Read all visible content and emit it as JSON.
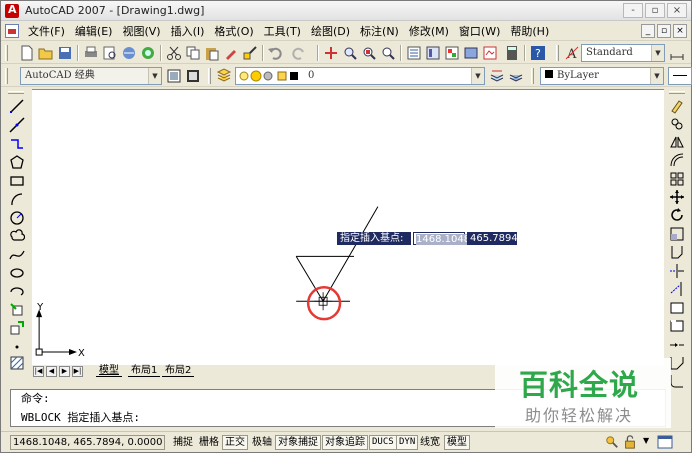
{
  "window": {
    "title": "AutoCAD 2007 - [Drawing1.dwg]",
    "controls": [
      "-",
      "▫",
      "×"
    ]
  },
  "menubar": {
    "items": [
      "文件(F)",
      "编辑(E)",
      "视图(V)",
      "插入(I)",
      "格式(O)",
      "工具(T)",
      "绘图(D)",
      "标注(N)",
      "修改(M)",
      "窗口(W)",
      "帮助(H)"
    ],
    "mdi_controls": [
      "_",
      "▫",
      "×"
    ]
  },
  "toolbar": {
    "text_style": "Standard"
  },
  "properties": {
    "workspace": "AutoCAD 经典",
    "layer": "0",
    "color": "ByLayer"
  },
  "layout_tabs": [
    "模型",
    "布局1",
    "布局2"
  ],
  "ucs": {
    "x_label": "X",
    "y_label": "Y"
  },
  "dynamic_input": {
    "prompt": "指定插入基点:",
    "x_value": "1468.1048",
    "y_value": "465.7894"
  },
  "command": {
    "line1": "命令:",
    "line2": "WBLOCK 指定插入基点:"
  },
  "status": {
    "coordinates": "1468.1048, 465.7894, 0.0000",
    "buttons": [
      "捕捉",
      "栅格",
      "正交",
      "极轴",
      "对象捕捉",
      "对象追踪",
      "DUCS",
      "DYN",
      "线宽",
      "模型"
    ]
  },
  "watermark": {
    "title": "百科全说",
    "subtitle": "助你轻松解决"
  },
  "colors": {
    "highlight_circle": "#e53935",
    "tooltip_bg": "#1f2a60",
    "watermark_green": "#2ea84a"
  }
}
